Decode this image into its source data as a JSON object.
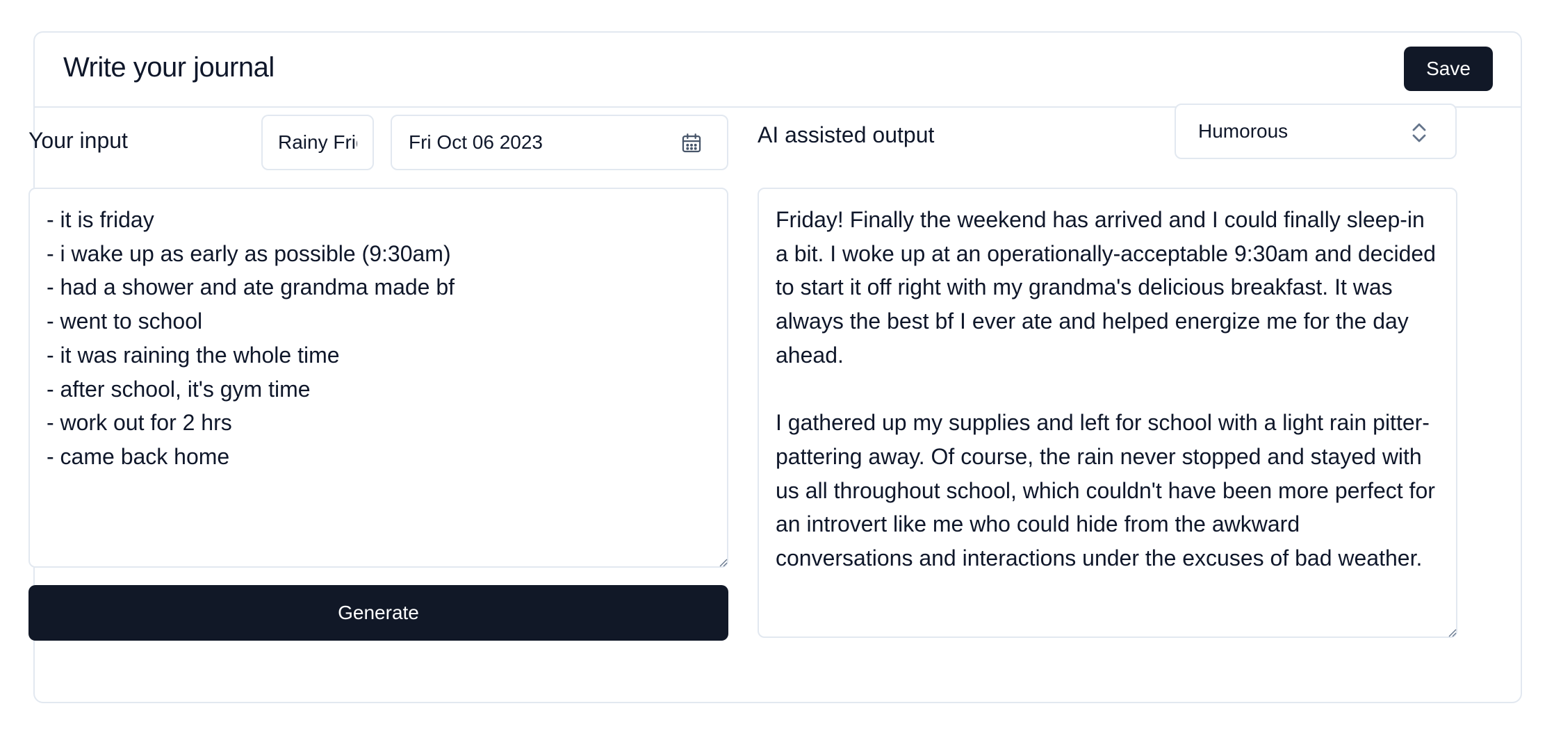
{
  "header": {
    "title": "Write your journal",
    "save_label": "Save"
  },
  "input_panel": {
    "label": "Your input",
    "title_value": "Rainy Friday",
    "date_value": "Fri Oct 06 2023",
    "notes": "- it is friday\n- i wake up as early as possible (9:30am)\n- had a shower and ate grandma made bf\n- went to school\n- it was raining the whole time\n- after school, it's gym time\n- work out for 2 hrs\n- came back home",
    "generate_label": "Generate"
  },
  "output_panel": {
    "label": "AI assisted output",
    "tone_selected": "Humorous",
    "text": "Friday! Finally the weekend has arrived and I could finally sleep-in a bit. I woke up at an operationally-acceptable 9:30am and decided to start it off right with my grandma's delicious breakfast. It was always the best bf I ever ate and helped energize me for the day ahead.\n\nI gathered up my supplies and left for school with a light rain pitter-pattering away. Of course, the rain never stopped and stayed with us all throughout school, which couldn't have been more perfect for an introvert like me who could hide from the awkward conversations and interactions under the excuses of bad weather."
  },
  "icons": {
    "date": "calendar-icon",
    "select": "chevron-up-down-icon",
    "grip": "resize-grip-icon"
  },
  "colors": {
    "primary_button": "#111827",
    "border": "#e2e8f0",
    "text": "#0f172a"
  }
}
